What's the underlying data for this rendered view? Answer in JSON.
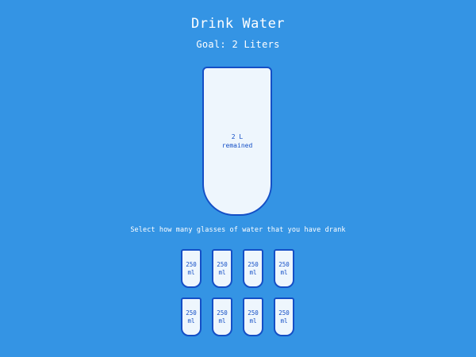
{
  "app": {
    "title": "Drink Water",
    "goal": "Goal: 2 Liters"
  },
  "big_cup": {
    "remained_value": "2 L",
    "remained_label": "remained",
    "filled_fraction": 0
  },
  "instruction": "Select how many glasses of water that you have drank",
  "cups": [
    {
      "amount": "250",
      "unit": "ml"
    },
    {
      "amount": "250",
      "unit": "ml"
    },
    {
      "amount": "250",
      "unit": "ml"
    },
    {
      "amount": "250",
      "unit": "ml"
    },
    {
      "amount": "250",
      "unit": "ml"
    },
    {
      "amount": "250",
      "unit": "ml"
    },
    {
      "amount": "250",
      "unit": "ml"
    },
    {
      "amount": "250",
      "unit": "ml"
    }
  ],
  "colors": {
    "background": "#3494e4",
    "cup_border": "#144fc6",
    "cup_fill": "#eef6fd",
    "water": "#6ab3f8"
  }
}
